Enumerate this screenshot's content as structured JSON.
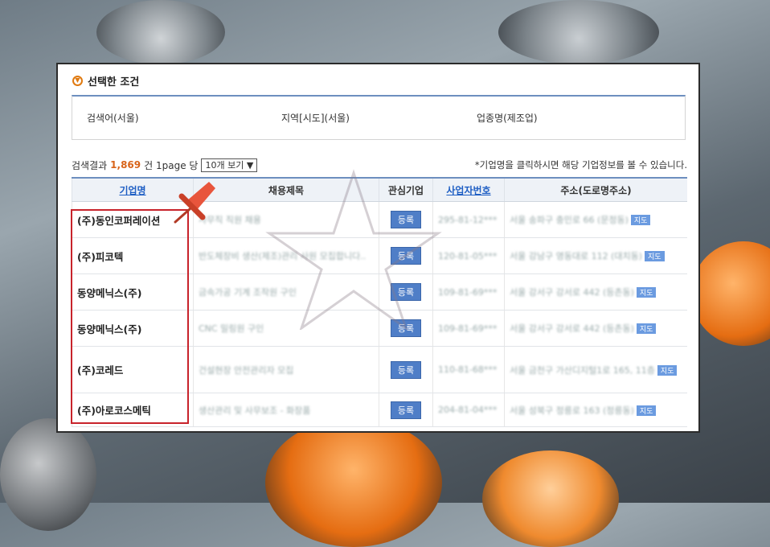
{
  "conditions": {
    "title": "선택한 조건",
    "items": [
      "검색어(서울)",
      "지역[시도](서울)",
      "업종명(제조업)"
    ]
  },
  "result": {
    "prefix": "검색결과",
    "count": "1,869",
    "suffix": "건 1page 당",
    "page_size": "10개 보기 ▼",
    "hint": "*기업명을 클릭하시면 해당 기업정보를 볼 수 있습니다."
  },
  "table": {
    "headers": [
      "기업명",
      "채용제목",
      "관심기업",
      "사업자번호",
      "주소(도로명주소)"
    ],
    "rows": [
      {
        "name": "(주)동인코퍼레이션",
        "title": "사무직 직원 채용",
        "button": "등록",
        "biz": "295-81-12***",
        "addr": "서울 송파구 충민로 66 (문정동)",
        "tag": "지도"
      },
      {
        "name": "(주)피코텍",
        "title": "반도체장비 생산(제조)관리 사원 모집합니다..",
        "button": "등록",
        "biz": "120-81-05***",
        "addr": "서울 강남구 영동대로 112 (대치동)",
        "tag": "지도"
      },
      {
        "name": "동양메닉스(주)",
        "title": "금속가공 기계 조작원 구인",
        "button": "등록",
        "biz": "109-81-69***",
        "addr": "서울 강서구 강서로 442 (등촌동)",
        "tag": "지도"
      },
      {
        "name": "동양메닉스(주)",
        "title": "CNC 밀링원 구인",
        "button": "등록",
        "biz": "109-81-69***",
        "addr": "서울 강서구 강서로 442 (등촌동)",
        "tag": "지도"
      },
      {
        "name": "(주)코레드",
        "title": "건설현장 안전관리자 모집",
        "button": "등록",
        "biz": "110-81-68***",
        "addr": "서울 금천구 가산디지털1로 165, 11층",
        "tag": "지도"
      },
      {
        "name": "(주)아로코스메틱",
        "title": "생산관리 및 사무보조 - 화장품",
        "button": "등록",
        "biz": "204-81-04***",
        "addr": "서울 성북구 정릉로 163 (정릉동)",
        "tag": "지도"
      }
    ]
  }
}
